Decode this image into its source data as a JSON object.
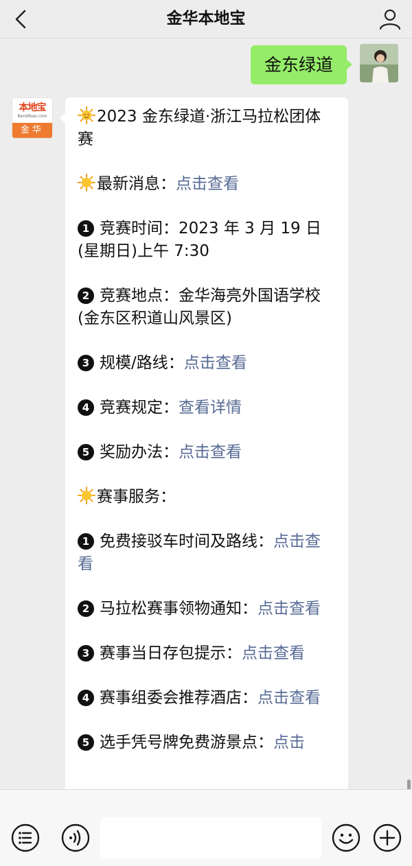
{
  "header": {
    "title": "金华本地宝"
  },
  "outgoing": {
    "text": "金东绿道"
  },
  "account": {
    "logo_main": "本地宝",
    "logo_sub": "Bendibao.com",
    "logo_city": "金华"
  },
  "message": {
    "title": "2023 金东绿道·浙江马拉松团体赛",
    "latest_label": "最新消息：",
    "latest_link": "点击查看",
    "items": [
      {
        "num": "1",
        "label": "竞赛时间：2023 年 3 月 19 日(星期日)上午 7:30",
        "link": ""
      },
      {
        "num": "2",
        "label": "竞赛地点：金华海亮外国语学校(金东区积道山风景区)",
        "link": ""
      },
      {
        "num": "3",
        "label": "规模/路线：",
        "link": "点击查看"
      },
      {
        "num": "4",
        "label": "竞赛规定：",
        "link": "查看详情"
      },
      {
        "num": "5",
        "label": "奖励办法：",
        "link": "点击查看"
      }
    ],
    "service_title": "赛事服务：",
    "services": [
      {
        "num": "1",
        "label": "免费接驳车时间及路线：",
        "link": "点击查看"
      },
      {
        "num": "2",
        "label": "马拉松赛事领物通知：",
        "link": "点击查看"
      },
      {
        "num": "3",
        "label": "赛事当日存包提示：",
        "link": "点击查看"
      },
      {
        "num": "4",
        "label": "赛事组委会推荐酒店：",
        "link": "点击查看"
      },
      {
        "num": "5",
        "label": "选手凭号牌免费游景点：",
        "link": "点击"
      }
    ]
  },
  "icons": {
    "back": "chevron-left-icon",
    "profile": "person-icon",
    "menu": "list-icon",
    "voice": "voice-icon",
    "emoji": "smiley-icon",
    "add": "plus-icon"
  },
  "colors": {
    "background": "#ededed",
    "outgoing_bubble": "#95ec69",
    "link": "#576b95",
    "logo_orange": "#ee7b30"
  }
}
